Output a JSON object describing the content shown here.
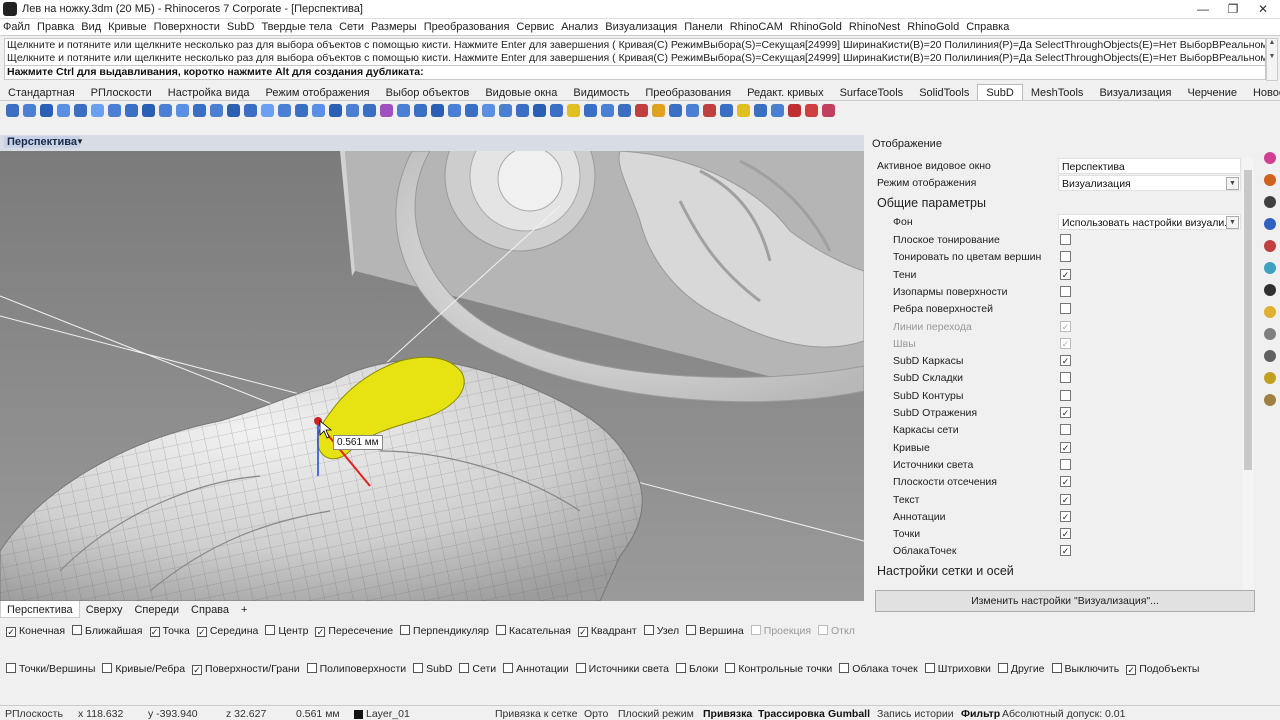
{
  "window": {
    "title": "Лев на ножку.3dm (20 МБ) - Rhinoceros 7 Corporate - [Перспектива]",
    "controls": [
      "—",
      "❐",
      "✕"
    ]
  },
  "menu": [
    "Файл",
    "Правка",
    "Вид",
    "Кривые",
    "Поверхности",
    "SubD",
    "Твердые тела",
    "Сети",
    "Размеры",
    "Преобразования",
    "Сервис",
    "Анализ",
    "Визуализация",
    "Панели",
    "RhinoCAM",
    "RhinoGold",
    "RhinoNest",
    "RhinoGold",
    "Справка"
  ],
  "command": {
    "history": [
      "Щелкните и потяните или щелкните несколько раз для выбора объектов с помощью кисти. Нажмите Enter для завершения ( Кривая(С)  РежимВыбора(S)=Секущая[24999]  ШиринаКисти(В)=20  Полилиния(P)=Да  SelectThroughObjects(E)=Нет  ВыборВРеальномВремени",
      "Щелкните и потяните или щелкните несколько раз для выбора объектов с помощью кисти. Нажмите Enter для завершения ( Кривая(С)  РежимВыбора(S)=Секущая[24999]  ШиринаКисти(В)=20  Полилиния(P)=Да  SelectThroughObjects(E)=Нет  ВыборВРеальномВремени"
    ],
    "prompt": "Нажмите Ctrl для выдавливания, коротко нажмите Alt для создания дубликата:"
  },
  "toolbar_tabs": [
    "Стандартная",
    "РПлоскости",
    "Настройка вида",
    "Режим отображения",
    "Выбор объектов",
    "Видовые окна",
    "Видимость",
    "Преобразования",
    "Редакт. кривых",
    "SurfaceTools",
    "SolidTools",
    "SubD",
    "MeshTools",
    "Визуализация",
    "Черчение",
    "Новое"
  ],
  "toolbar_tabs_active": "SubD",
  "viewport": {
    "name": "Перспектива",
    "dimension_label": "0.561 мм"
  },
  "viewport_tabs": [
    "Перспектива",
    "Сверху",
    "Спереди",
    "Справа",
    "+"
  ],
  "panel": {
    "title": "Отображение",
    "active_viewport_label": "Активное видовое окно",
    "active_viewport_value": "Перспектива",
    "display_mode_label": "Режим отображения",
    "display_mode_value": "Визуализация",
    "general_section": "Общие параметры",
    "background_label": "Фон",
    "background_value": "Использовать настройки визуали...",
    "options": [
      {
        "label": "Плоское тонирование",
        "checked": false,
        "dim": false
      },
      {
        "label": "Тонировать по цветам вершин",
        "checked": false,
        "dim": false
      },
      {
        "label": "Тени",
        "checked": true,
        "dim": false
      },
      {
        "label": "Изопармы поверхности",
        "checked": false,
        "dim": false
      },
      {
        "label": "Ребра поверхностей",
        "checked": false,
        "dim": false
      },
      {
        "label": "Линии перехода",
        "checked": true,
        "dim": true
      },
      {
        "label": "Швы",
        "checked": true,
        "dim": true
      },
      {
        "label": "SubD Каркасы",
        "checked": true,
        "dim": false
      },
      {
        "label": "SubD Складки",
        "checked": false,
        "dim": false
      },
      {
        "label": "SubD Контуры",
        "checked": false,
        "dim": false
      },
      {
        "label": "SubD Отражения",
        "checked": true,
        "dim": false
      },
      {
        "label": "Каркасы сети",
        "checked": false,
        "dim": false
      },
      {
        "label": "Кривые",
        "checked": true,
        "dim": false
      },
      {
        "label": "Источники света",
        "checked": false,
        "dim": false
      },
      {
        "label": "Плоскости отсечения",
        "checked": true,
        "dim": false
      },
      {
        "label": "Текст",
        "checked": true,
        "dim": false
      },
      {
        "label": "Аннотации",
        "checked": true,
        "dim": false
      },
      {
        "label": "Точки",
        "checked": true,
        "dim": false
      },
      {
        "label": "ОблакаТочек",
        "checked": true,
        "dim": false
      }
    ],
    "grid_section": "Настройки сетки и осей",
    "modify_button": "Изменить настройки \"Визуализация\"..."
  },
  "osnaps_row1": [
    {
      "label": "Конечная",
      "checked": true,
      "dim": false
    },
    {
      "label": "Ближайшая",
      "checked": false,
      "dim": false
    },
    {
      "label": "Точка",
      "checked": true,
      "dim": false
    },
    {
      "label": "Середина",
      "checked": true,
      "dim": false
    },
    {
      "label": "Центр",
      "checked": false,
      "dim": false
    },
    {
      "label": "Пересечение",
      "checked": true,
      "dim": false
    },
    {
      "label": "Перпендикуляр",
      "checked": false,
      "dim": false
    },
    {
      "label": "Касательная",
      "checked": false,
      "dim": false
    },
    {
      "label": "Квадрант",
      "checked": true,
      "dim": false
    },
    {
      "label": "Узел",
      "checked": false,
      "dim": false
    },
    {
      "label": "Вершина",
      "checked": false,
      "dim": false
    },
    {
      "label": "Проекция",
      "checked": false,
      "dim": true
    },
    {
      "label": "Откл",
      "checked": false,
      "dim": true
    }
  ],
  "osnaps_row2": [
    {
      "label": "Точки/Вершины",
      "checked": false,
      "dim": false
    },
    {
      "label": "Кривые/Ребра",
      "checked": false,
      "dim": false
    },
    {
      "label": "Поверхности/Грани",
      "checked": true,
      "dim": false
    },
    {
      "label": "Полиповерхности",
      "checked": false,
      "dim": false
    },
    {
      "label": "SubD",
      "checked": false,
      "dim": false
    },
    {
      "label": "Сети",
      "checked": false,
      "dim": false
    },
    {
      "label": "Аннотации",
      "checked": false,
      "dim": false
    },
    {
      "label": "Источники света",
      "checked": false,
      "dim": false
    },
    {
      "label": "Блоки",
      "checked": false,
      "dim": false
    },
    {
      "label": "Контрольные точки",
      "checked": false,
      "dim": false
    },
    {
      "label": "Облака точек",
      "checked": false,
      "dim": false
    },
    {
      "label": "Штриховки",
      "checked": false,
      "dim": false
    },
    {
      "label": "Другие",
      "checked": false,
      "dim": false
    },
    {
      "label": "Выключить",
      "checked": false,
      "dim": false
    },
    {
      "label": "Подобъекты",
      "checked": true,
      "dim": false
    }
  ],
  "status": {
    "cplane": "РПлоскость",
    "x": "x 118.632",
    "y": "y -393.940",
    "z": "z 32.627",
    "dist": "0.561 мм",
    "layer": "Layer_01",
    "grid_snap": "Привязка к сетке",
    "ortho": "Орто",
    "planar": "Плоский режим",
    "osnap": "Привязка",
    "smarttrack": "Трассировка",
    "gumball": "Gumball",
    "history": "Запись истории",
    "filter": "Фильтр",
    "tolerance": "Абсолютный допуск: 0.01"
  }
}
